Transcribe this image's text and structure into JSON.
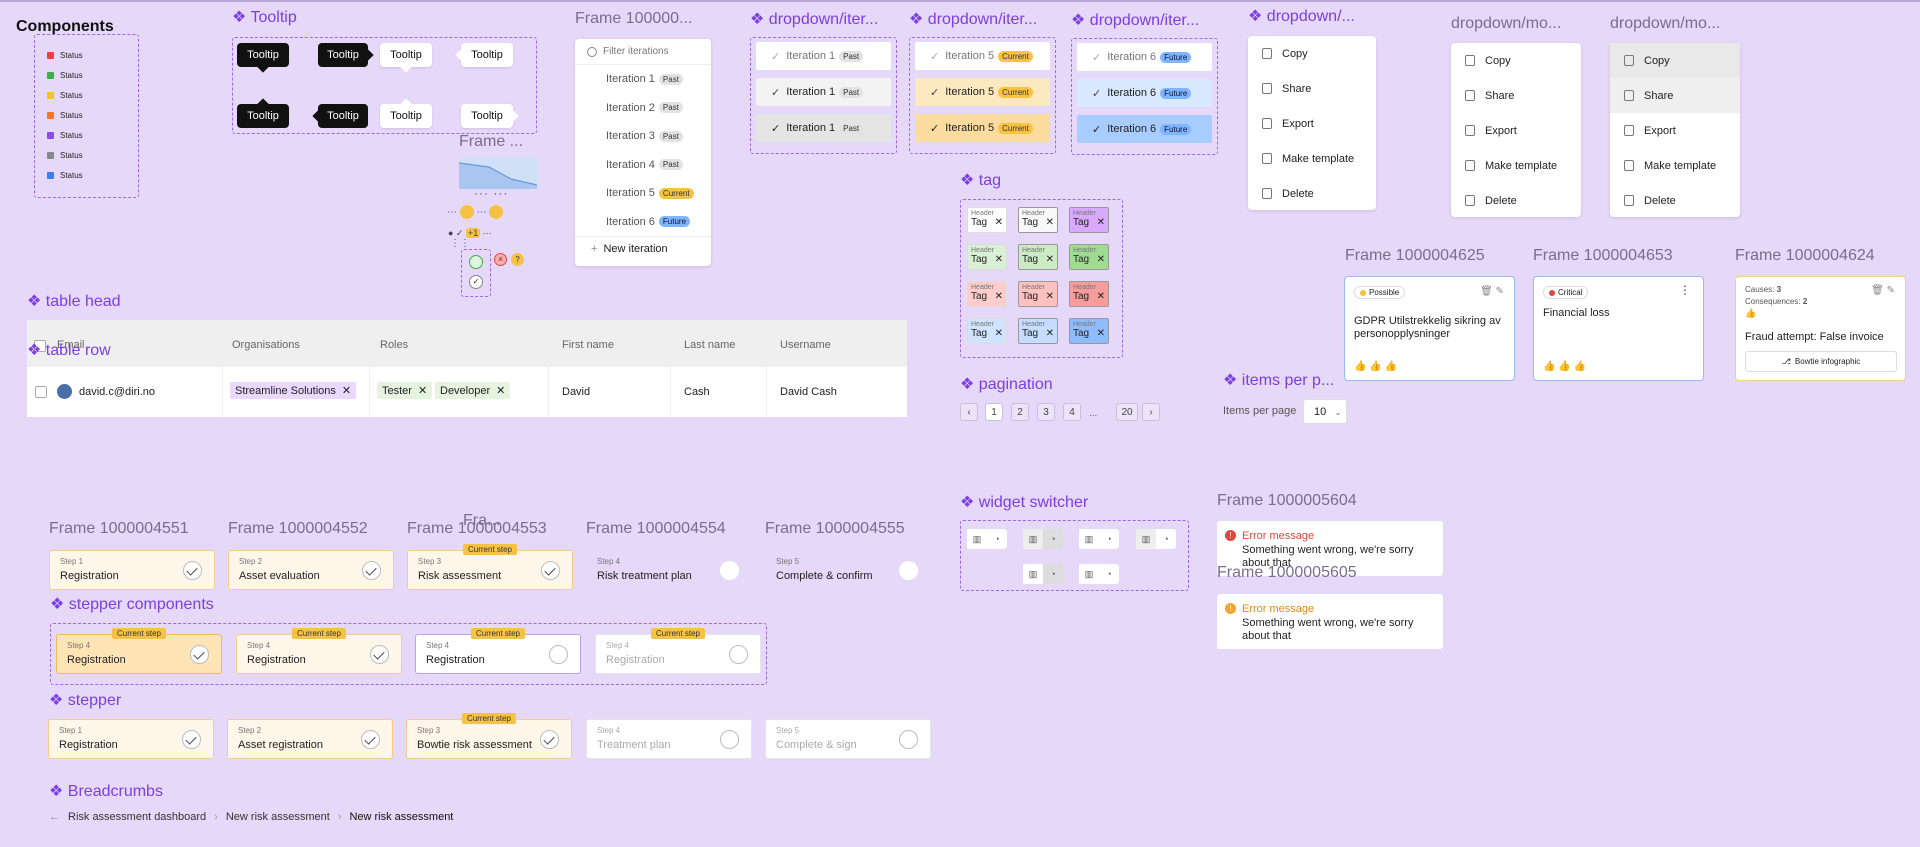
{
  "components": {
    "title": "Components",
    "status_items": [
      "Status",
      "Status",
      "Status",
      "Status",
      "Status",
      "Status",
      "Status"
    ],
    "status_colors": [
      "#e0463f",
      "#3cae4a",
      "#f2c230",
      "#f07a2a",
      "#8a4ee8",
      "#888888",
      "#3b7cf0"
    ]
  },
  "tooltip": {
    "title": "Tooltip",
    "label": "Tooltip"
  },
  "frames": {
    "iter_frame": "Frame 100000...",
    "frame_small": "Frame ...",
    "dd_iter_1": "dropdown/iter...",
    "dd_iter_2": "dropdown/iter...",
    "dd_iter_3": "dropdown/iter...",
    "dd_mo_title": "dropdown/...",
    "dd_mo_2": "dropdown/mo...",
    "dd_mo_3": "dropdown/mo..."
  },
  "iteration_dropdown": {
    "placeholder": "Filter iterations",
    "items": [
      {
        "label": "Iteration 1",
        "badge": "Past"
      },
      {
        "label": "Iteration 2",
        "badge": "Past"
      },
      {
        "label": "Iteration 3",
        "badge": "Past"
      },
      {
        "label": "Iteration 4",
        "badge": "Past"
      },
      {
        "label": "Iteration 5",
        "badge": "Current"
      },
      {
        "label": "Iteration 6",
        "badge": "Future"
      }
    ],
    "new_label": "New iteration"
  },
  "iter_variants": {
    "past": {
      "label": "Iteration 1",
      "badge": "Past"
    },
    "current": {
      "label": "Iteration 5",
      "badge": "Current"
    },
    "future": {
      "label": "Iteration 6",
      "badge": "Future"
    }
  },
  "menu": [
    "Copy",
    "Share",
    "Export",
    "Make template",
    "Delete"
  ],
  "tag": {
    "title": "tag",
    "header": "Header",
    "label": "Tag"
  },
  "pagination": {
    "title": "pagination",
    "pages": [
      "1",
      "2",
      "3",
      "4",
      "...",
      "20"
    ]
  },
  "items_per_page": {
    "title": "items per p...",
    "label": "Items per page",
    "value": "10"
  },
  "risk_cards": [
    {
      "frame": "Frame 1000004625",
      "status": "Possible",
      "title": "GDPR Utilstrekkelig sikring av personopplysninger"
    },
    {
      "frame": "Frame 1000004653",
      "status": "Critical",
      "title": "Financial loss"
    },
    {
      "frame": "Frame 1000004624",
      "causes_label": "Causes:",
      "causes": "3",
      "cons_label": "Consequences:",
      "cons": "2",
      "title": "Fraud attempt: False invoice",
      "button": "Bowtie infographic"
    }
  ],
  "table": {
    "head_title": "table head",
    "row_title": "table row",
    "headers": [
      "Email",
      "Organisations",
      "Roles",
      "First name",
      "Last name",
      "Username"
    ],
    "row": {
      "email": "david.c@diri.no",
      "org": "Streamline Solutions",
      "roles": [
        "Tester",
        "Developer"
      ],
      "first": "David",
      "last": "Cash",
      "username": "David Cash"
    }
  },
  "widget_switcher": {
    "title": "widget switcher"
  },
  "errors": [
    {
      "frame": "Frame 1000005604",
      "title": "Error message",
      "text": "Something went wrong, we're sorry about that"
    },
    {
      "frame": "Frame 1000005605",
      "title": "Error message",
      "text": "Something went wrong, we're sorry about that"
    }
  ],
  "step_frames": {
    "titles": [
      "Frame 1000004551",
      "Frame 1000004552",
      "Frame 1000004553",
      "Frame 1000004554",
      "Frame 1000004555"
    ],
    "overlap": "Fra...",
    "steps": [
      {
        "small": "Step 1",
        "label": "Registration"
      },
      {
        "small": "Step 2",
        "label": "Asset evaluation"
      },
      {
        "small": "Step 3",
        "label": "Risk assessment"
      },
      {
        "small": "Step 4",
        "label": "Risk treatment plan"
      },
      {
        "small": "Step 5",
        "label": "Complete & confirm"
      }
    ]
  },
  "stepper_components": {
    "title": "stepper components",
    "small": "Step 4",
    "label": "Registration",
    "current": "Current step"
  },
  "stepper": {
    "title": "stepper",
    "steps": [
      {
        "small": "Step 1",
        "label": "Registration"
      },
      {
        "small": "Step 2",
        "label": "Asset registration"
      },
      {
        "small": "Step 3",
        "label": "Bowtie risk assessment"
      },
      {
        "small": "Step 4",
        "label": "Treatment plan"
      },
      {
        "small": "Step 5",
        "label": "Complete & sign"
      }
    ]
  },
  "breadcrumbs": {
    "title": "Breadcrumbs",
    "items": [
      "Risk assessment dashboard",
      "New risk assessment",
      "New risk assessment"
    ]
  }
}
